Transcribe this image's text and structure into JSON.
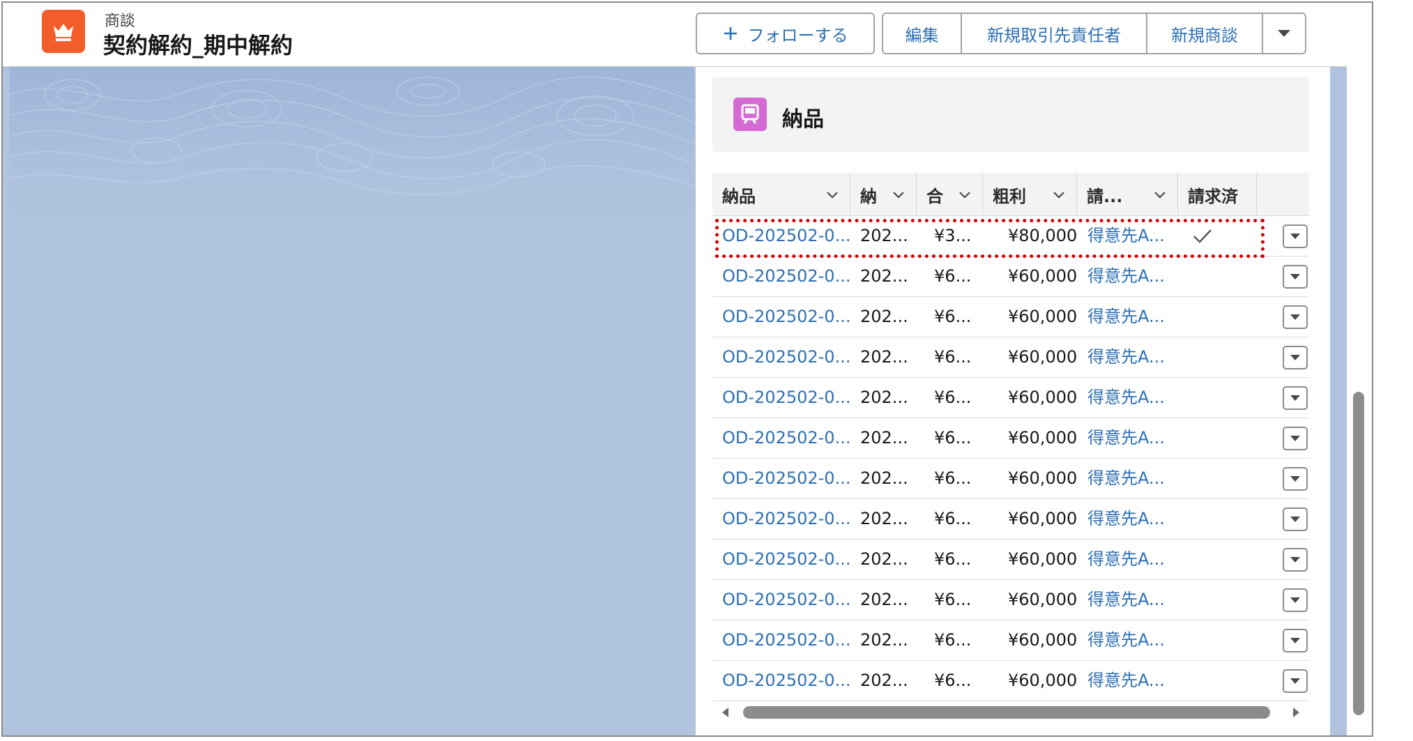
{
  "header": {
    "object_label": "商談",
    "record_title": "契約解約_期中解約",
    "record_icon": "crown-icon",
    "follow_label": "フォローする",
    "buttons": [
      "編集",
      "新規取引先責任者",
      "新規商談"
    ],
    "colors": {
      "record_icon": "#f35d2a",
      "button_text": "#2c6fb5"
    }
  },
  "card": {
    "title": "納品",
    "icon": "delivery-icon",
    "icon_color": "#d56ad4",
    "columns": [
      "納品",
      "納",
      "合",
      "粗利",
      "請...",
      "請求済"
    ],
    "rows": [
      {
        "id": "OD-202502-0...",
        "date": "202...",
        "total": "¥3...",
        "profit": "¥80,000",
        "account": "得意先A...",
        "billed": true
      },
      {
        "id": "OD-202502-0...",
        "date": "202...",
        "total": "¥6...",
        "profit": "¥60,000",
        "account": "得意先A...",
        "billed": false
      },
      {
        "id": "OD-202502-0...",
        "date": "202...",
        "total": "¥6...",
        "profit": "¥60,000",
        "account": "得意先A...",
        "billed": false
      },
      {
        "id": "OD-202502-0...",
        "date": "202...",
        "total": "¥6...",
        "profit": "¥60,000",
        "account": "得意先A...",
        "billed": false
      },
      {
        "id": "OD-202502-0...",
        "date": "202...",
        "total": "¥6...",
        "profit": "¥60,000",
        "account": "得意先A...",
        "billed": false
      },
      {
        "id": "OD-202502-0...",
        "date": "202...",
        "total": "¥6...",
        "profit": "¥60,000",
        "account": "得意先A...",
        "billed": false
      },
      {
        "id": "OD-202502-0...",
        "date": "202...",
        "total": "¥6...",
        "profit": "¥60,000",
        "account": "得意先A...",
        "billed": false
      },
      {
        "id": "OD-202502-0...",
        "date": "202...",
        "total": "¥6...",
        "profit": "¥60,000",
        "account": "得意先A...",
        "billed": false
      },
      {
        "id": "OD-202502-0...",
        "date": "202...",
        "total": "¥6...",
        "profit": "¥60,000",
        "account": "得意先A...",
        "billed": false
      },
      {
        "id": "OD-202502-0...",
        "date": "202...",
        "total": "¥6...",
        "profit": "¥60,000",
        "account": "得意先A...",
        "billed": false
      },
      {
        "id": "OD-202502-0...",
        "date": "202...",
        "total": "¥6...",
        "profit": "¥60,000",
        "account": "得意先A...",
        "billed": false
      },
      {
        "id": "OD-202502-0...",
        "date": "202...",
        "total": "¥6...",
        "profit": "¥60,000",
        "account": "得意先A...",
        "billed": false
      }
    ],
    "highlight_color": "#d40000",
    "highlighted_row": 0
  }
}
